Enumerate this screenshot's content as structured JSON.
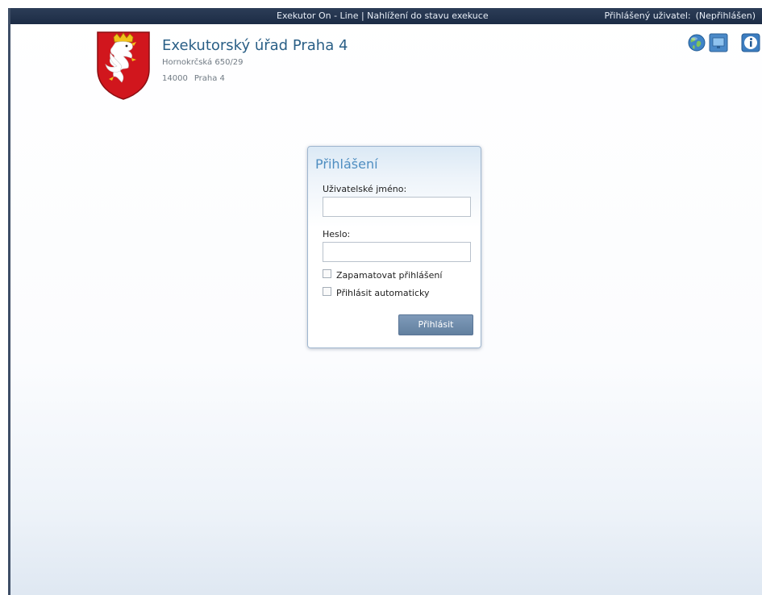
{
  "topbar": {
    "title": "Exekutor On - Line | Nahlížení do stavu exekuce",
    "user_label": "Přihlášený uživatel:",
    "user_value": "(Nepřihlášen)"
  },
  "office": {
    "name": "Exekutorský úřad Praha 4",
    "address": "Hornokrčská 650/29",
    "zip": "14000",
    "city": "Praha 4"
  },
  "icons": [
    "czech-lion-crest",
    "globe-icon",
    "monitor-icon",
    "info-icon"
  ],
  "login": {
    "title": "Přihlášení",
    "username_label": "Uživatelské jméno:",
    "username_value": "",
    "password_label": "Heslo:",
    "password_value": "",
    "remember_label": "Zapamatovat přihlášení",
    "remember_checked": false,
    "auto_label": "Přihlásit automaticky",
    "auto_checked": false,
    "submit_label": "Přihlásit"
  },
  "colors": {
    "topbar_bg": "#1c2c45",
    "accent": "#4f8ec1",
    "button_bg": "#6a87a7",
    "crest_red": "#d1161d"
  }
}
